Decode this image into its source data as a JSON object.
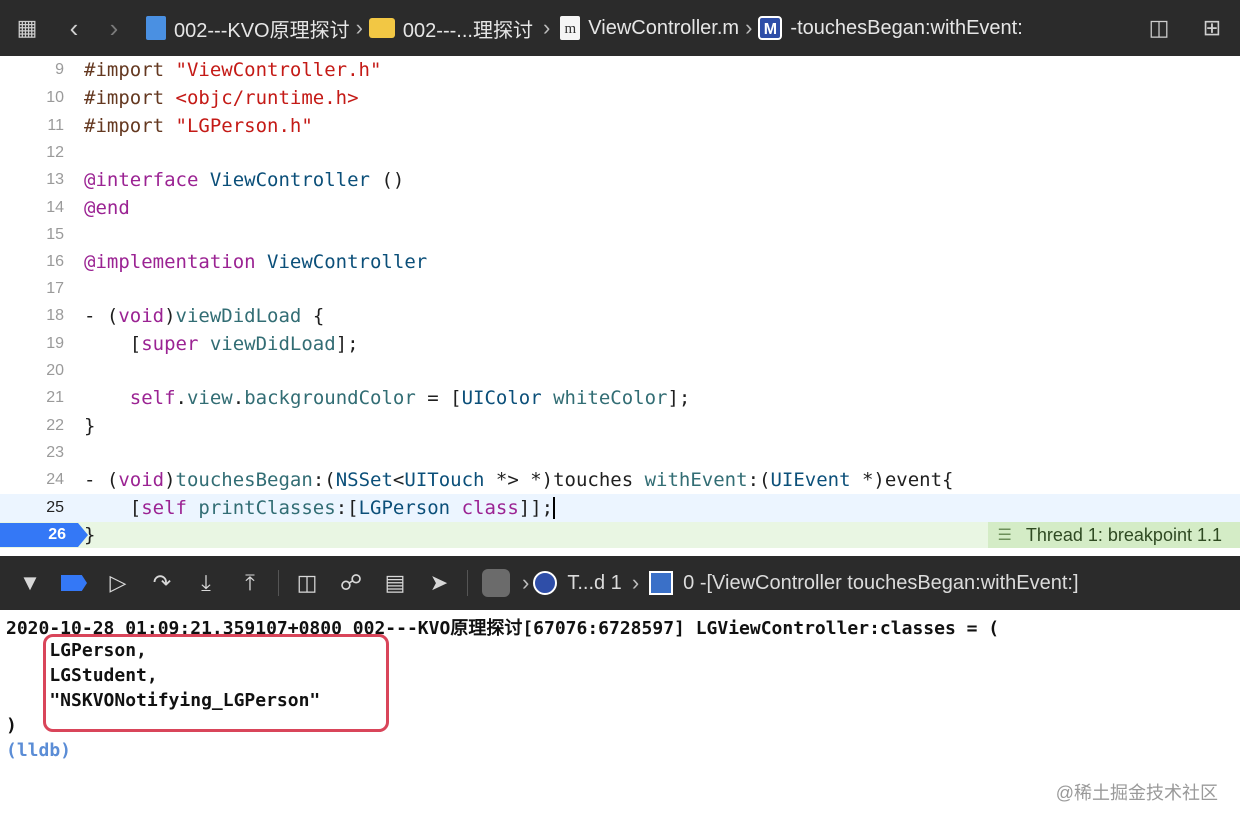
{
  "jumpbar": {
    "crumbs": [
      {
        "label": "002---KVO原理探讨",
        "icon": "project-file-icon"
      },
      {
        "label": "002---...理探讨",
        "icon": "folder-icon"
      },
      {
        "label": "ViewController.m",
        "icon": "objc-file-icon"
      },
      {
        "label": "-touchesBegan:withEvent:",
        "icon": "method-icon",
        "badge": "M"
      }
    ],
    "file_badge": "m"
  },
  "editor": {
    "lines": [
      {
        "n": "9",
        "text": "#import \"ViewController.h\""
      },
      {
        "n": "10",
        "text": "#import <objc/runtime.h>"
      },
      {
        "n": "11",
        "text": "#import \"LGPerson.h\""
      },
      {
        "n": "12",
        "text": ""
      },
      {
        "n": "13",
        "text": "@interface ViewController ()"
      },
      {
        "n": "14",
        "text": "@end"
      },
      {
        "n": "15",
        "text": ""
      },
      {
        "n": "16",
        "text": "@implementation ViewController"
      },
      {
        "n": "17",
        "text": ""
      },
      {
        "n": "18",
        "text": "- (void)viewDidLoad {"
      },
      {
        "n": "19",
        "text": "    [super viewDidLoad];"
      },
      {
        "n": "20",
        "text": ""
      },
      {
        "n": "21",
        "text": "    self.view.backgroundColor = [UIColor whiteColor];"
      },
      {
        "n": "22",
        "text": "}"
      },
      {
        "n": "23",
        "text": ""
      },
      {
        "n": "24",
        "text": "- (void)touchesBegan:(NSSet<UITouch *> *)touches withEvent:(UIEvent *)event{"
      },
      {
        "n": "25",
        "text": "    [self printClasses:[LGPerson class]];"
      },
      {
        "n": "26",
        "text": "}"
      }
    ],
    "breakpoint_line": "26",
    "thread_label": "Thread 1: breakpoint 1.1"
  },
  "debugbar": {
    "thread": "T...d 1",
    "frame": "0 -[ViewController touchesBegan:withEvent:]"
  },
  "console": {
    "lines": [
      "2020-10-28 01:09:21.359107+0800 002---KVO原理探讨[67076:6728597] LGViewController:classes = (",
      "    LGPerson,",
      "    LGStudent,",
      "    \"NSKVONotifying_LGPerson\"",
      ")"
    ],
    "prompt": "(lldb)"
  },
  "watermark": "@稀土掘金技术社区",
  "colors": {
    "toolbar_bg": "#2b2b2b",
    "breakpoint_blue": "#3478f6",
    "current_line_bg": "#ecf5ff",
    "breakpoint_line_bg": "#e9f6e3",
    "thread_label_bg": "#d4ecc6",
    "highlight_box": "#d9455a",
    "lldb_prompt": "#5b8dd6"
  }
}
